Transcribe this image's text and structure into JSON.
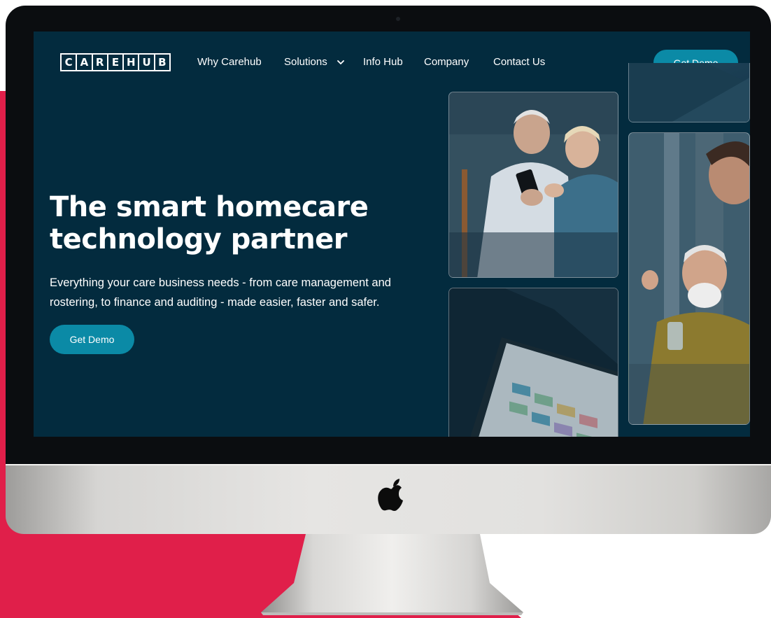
{
  "brand": {
    "logo_letters": [
      "C",
      "A",
      "R",
      "E",
      "H",
      "U",
      "B"
    ]
  },
  "nav": {
    "items": [
      {
        "label": "Why Carehub"
      },
      {
        "label": "Solutions",
        "icon": "chevron-down-icon"
      },
      {
        "label": "Info Hub"
      },
      {
        "label": "Company"
      },
      {
        "label": "Contact Us"
      }
    ],
    "cta_label": "Get Demo"
  },
  "hero": {
    "title": "The smart homecare technology partner",
    "subtitle": "Everything your care business needs - from care management and rostering, to finance and auditing - made easier, faster and safer.",
    "cta_label": "Get Demo"
  },
  "colors": {
    "screen_background": "#032b3e",
    "button": "#0b8aa6",
    "accent_red": "#e01f4a",
    "text": "#ffffff"
  },
  "icons": [
    "chevron-down-icon",
    "apple-logo-icon"
  ]
}
